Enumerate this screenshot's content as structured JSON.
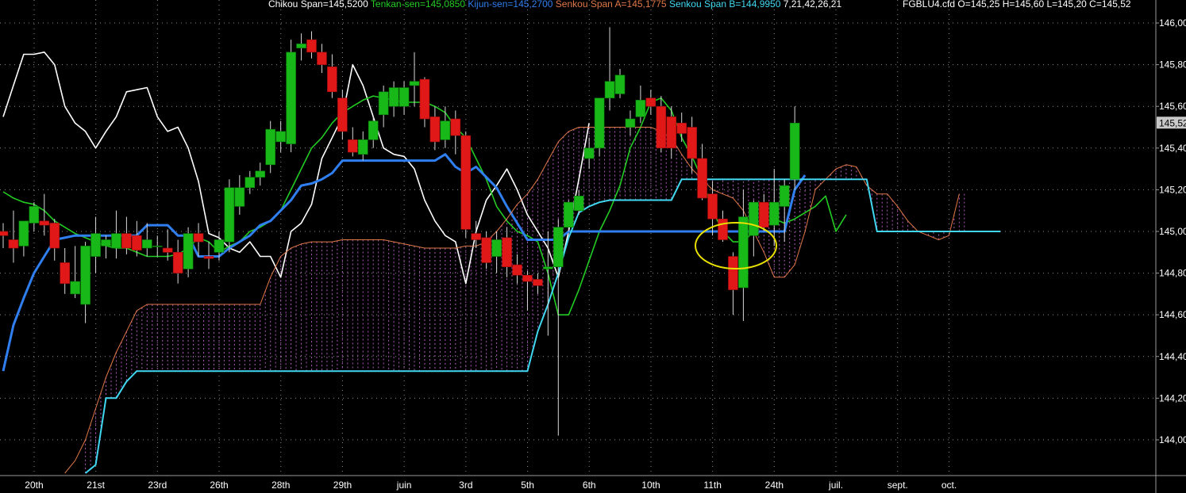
{
  "legend": {
    "chikou": "Chikou Span=145,5200",
    "tenkan": "Tenkan-sen=145,0850",
    "kijun": "Kijun-sen=145,2700",
    "spanA": "Senkou Span A=145,1775",
    "spanB": "Senkou Span B=144,9950",
    "params": "7,21,42,26,21",
    "ohlc": "FGBLU4.cfd O=145,25 H=145,60 L=145,20 C=145,52"
  },
  "colors": {
    "background": "#000000",
    "grid": "#8a8a8a",
    "up": "#18b818",
    "down": "#e01818",
    "chikou": "#ffffff",
    "tenkan": "#22cc22",
    "kijun": "#2f7ff0",
    "spanA": "#e07848",
    "spanB": "#40d8f0",
    "cloud": "#c060d0",
    "highlight": "#e8e000",
    "axis_text": "#ffffff"
  },
  "chart_data": {
    "type": "candlestick",
    "ylim": [
      143.84,
      146.08
    ],
    "y_ticks": [
      "146,00",
      "145,80",
      "145,60",
      "145,40",
      "145,20",
      "145,00",
      "144,80",
      "144,60",
      "144,40",
      "144,20",
      "144,00"
    ],
    "current_price_label": "145,52",
    "x_ticks": [
      {
        "label": "20th",
        "i": 1
      },
      {
        "label": "21st",
        "i": 7
      },
      {
        "label": "23rd",
        "i": 13
      },
      {
        "label": "26th",
        "i": 19
      },
      {
        "label": "28th",
        "i": 25
      },
      {
        "label": "29th",
        "i": 31
      },
      {
        "label": "juin",
        "i": 37
      },
      {
        "label": "3rd",
        "i": 43
      },
      {
        "label": "5th",
        "i": 49
      },
      {
        "label": "6th",
        "i": 55
      },
      {
        "label": "10th",
        "i": 61
      },
      {
        "label": "11th",
        "i": 67
      },
      {
        "label": "24th",
        "i": 73
      },
      {
        "label": "juil.",
        "i": 79
      },
      {
        "label": "sept.",
        "i": 85
      },
      {
        "label": "oct.",
        "i": 90
      }
    ],
    "candles": [
      {
        "o": 145.0,
        "h": 145.04,
        "l": 144.92,
        "c": 144.98
      },
      {
        "o": 144.96,
        "h": 145.1,
        "l": 144.85,
        "c": 144.92
      },
      {
        "o": 144.93,
        "h": 145.02,
        "l": 144.88,
        "c": 145.05
      },
      {
        "o": 145.04,
        "h": 145.14,
        "l": 145.0,
        "c": 145.12
      },
      {
        "o": 145.05,
        "h": 145.18,
        "l": 144.98,
        "c": 145.03
      },
      {
        "o": 145.04,
        "h": 145.06,
        "l": 144.86,
        "c": 144.92
      },
      {
        "o": 144.85,
        "h": 144.92,
        "l": 144.7,
        "c": 144.75
      },
      {
        "o": 144.7,
        "h": 144.93,
        "l": 144.68,
        "c": 144.76
      },
      {
        "o": 144.65,
        "h": 144.95,
        "l": 144.56,
        "c": 144.93
      },
      {
        "o": 144.88,
        "h": 145.07,
        "l": 144.8,
        "c": 144.99
      },
      {
        "o": 144.93,
        "h": 144.98,
        "l": 144.87,
        "c": 144.96
      },
      {
        "o": 144.92,
        "h": 145.1,
        "l": 144.87,
        "c": 144.99
      },
      {
        "o": 144.99,
        "h": 145.07,
        "l": 144.89,
        "c": 144.92
      },
      {
        "o": 144.98,
        "h": 145.05,
        "l": 144.88,
        "c": 144.91
      },
      {
        "o": 144.92,
        "h": 145.04,
        "l": 144.88,
        "c": 144.96
      },
      {
        "o": 144.93,
        "h": 144.98,
        "l": 144.88,
        "c": 144.93
      },
      {
        "o": 144.92,
        "h": 145.01,
        "l": 144.86,
        "c": 144.9
      },
      {
        "o": 144.9,
        "h": 144.96,
        "l": 144.75,
        "c": 144.8
      },
      {
        "o": 144.82,
        "h": 145.02,
        "l": 144.78,
        "c": 144.99
      },
      {
        "o": 144.99,
        "h": 145.04,
        "l": 144.88,
        "c": 144.95
      },
      {
        "o": 144.88,
        "h": 144.95,
        "l": 144.82,
        "c": 144.87
      },
      {
        "o": 144.9,
        "h": 145.0,
        "l": 144.86,
        "c": 144.96
      },
      {
        "o": 144.95,
        "h": 145.25,
        "l": 144.9,
        "c": 145.21
      },
      {
        "o": 145.12,
        "h": 145.27,
        "l": 145.08,
        "c": 145.21
      },
      {
        "o": 145.21,
        "h": 145.29,
        "l": 145.18,
        "c": 145.26
      },
      {
        "o": 145.26,
        "h": 145.33,
        "l": 145.22,
        "c": 145.29
      },
      {
        "o": 145.32,
        "h": 145.53,
        "l": 145.28,
        "c": 145.49
      },
      {
        "o": 145.43,
        "h": 145.53,
        "l": 145.38,
        "c": 145.48
      },
      {
        "o": 145.42,
        "h": 145.92,
        "l": 145.38,
        "c": 145.86
      },
      {
        "o": 145.88,
        "h": 145.95,
        "l": 145.82,
        "c": 145.9
      },
      {
        "o": 145.92,
        "h": 145.96,
        "l": 145.83,
        "c": 145.86
      },
      {
        "o": 145.86,
        "h": 145.9,
        "l": 145.76,
        "c": 145.8
      },
      {
        "o": 145.79,
        "h": 145.85,
        "l": 145.64,
        "c": 145.67
      },
      {
        "o": 145.64,
        "h": 145.68,
        "l": 145.44,
        "c": 145.48
      },
      {
        "o": 145.44,
        "h": 145.5,
        "l": 145.36,
        "c": 145.38
      },
      {
        "o": 145.37,
        "h": 145.48,
        "l": 145.34,
        "c": 145.44
      },
      {
        "o": 145.44,
        "h": 145.55,
        "l": 145.4,
        "c": 145.53
      },
      {
        "o": 145.56,
        "h": 145.7,
        "l": 145.5,
        "c": 145.67
      },
      {
        "o": 145.6,
        "h": 145.72,
        "l": 145.55,
        "c": 145.69
      },
      {
        "o": 145.6,
        "h": 145.72,
        "l": 145.56,
        "c": 145.69
      },
      {
        "o": 145.7,
        "h": 145.86,
        "l": 145.6,
        "c": 145.72
      },
      {
        "o": 145.73,
        "h": 145.74,
        "l": 145.5,
        "c": 145.54
      },
      {
        "o": 145.55,
        "h": 145.6,
        "l": 145.39,
        "c": 145.43
      },
      {
        "o": 145.44,
        "h": 145.6,
        "l": 145.4,
        "c": 145.53
      },
      {
        "o": 145.54,
        "h": 145.58,
        "l": 145.37,
        "c": 145.46
      },
      {
        "o": 145.46,
        "h": 145.48,
        "l": 144.97,
        "c": 145.01
      },
      {
        "o": 144.99,
        "h": 145.05,
        "l": 144.92,
        "c": 144.96
      },
      {
        "o": 144.97,
        "h": 145.0,
        "l": 144.82,
        "c": 144.85
      },
      {
        "o": 144.88,
        "h": 145.0,
        "l": 144.8,
        "c": 144.96
      },
      {
        "o": 144.97,
        "h": 145.02,
        "l": 144.78,
        "c": 144.83
      },
      {
        "o": 144.84,
        "h": 144.89,
        "l": 144.75,
        "c": 144.79
      },
      {
        "o": 144.79,
        "h": 144.81,
        "l": 144.62,
        "c": 144.76
      },
      {
        "o": 144.77,
        "h": 144.8,
        "l": 144.7,
        "c": 144.74
      },
      {
        "o": 144.82,
        "h": 145.0,
        "l": 144.5,
        "c": 144.83
      },
      {
        "o": 144.83,
        "h": 145.06,
        "l": 144.02,
        "c": 145.02
      },
      {
        "o": 145.02,
        "h": 145.15,
        "l": 145.0,
        "c": 145.14
      },
      {
        "o": 145.1,
        "h": 145.2,
        "l": 145.08,
        "c": 145.17
      },
      {
        "o": 145.35,
        "h": 145.45,
        "l": 145.3,
        "c": 145.4
      },
      {
        "o": 145.4,
        "h": 145.6,
        "l": 145.36,
        "c": 145.64
      },
      {
        "o": 145.64,
        "h": 145.98,
        "l": 145.58,
        "c": 145.72
      },
      {
        "o": 145.66,
        "h": 145.78,
        "l": 145.64,
        "c": 145.75
      },
      {
        "o": 145.5,
        "h": 145.58,
        "l": 145.46,
        "c": 145.54
      },
      {
        "o": 145.55,
        "h": 145.7,
        "l": 145.52,
        "c": 145.63
      },
      {
        "o": 145.64,
        "h": 145.68,
        "l": 145.56,
        "c": 145.6
      },
      {
        "o": 145.6,
        "h": 145.65,
        "l": 145.38,
        "c": 145.4
      },
      {
        "o": 145.55,
        "h": 145.6,
        "l": 145.35,
        "c": 145.4
      },
      {
        "o": 145.52,
        "h": 145.57,
        "l": 145.43,
        "c": 145.47
      },
      {
        "o": 145.5,
        "h": 145.55,
        "l": 145.28,
        "c": 145.35
      },
      {
        "o": 145.35,
        "h": 145.42,
        "l": 145.15,
        "c": 145.16
      },
      {
        "o": 145.18,
        "h": 145.24,
        "l": 144.98,
        "c": 145.06
      },
      {
        "o": 145.06,
        "h": 145.1,
        "l": 144.95,
        "c": 144.96
      },
      {
        "o": 144.88,
        "h": 144.9,
        "l": 144.6,
        "c": 144.72
      },
      {
        "o": 144.73,
        "h": 145.2,
        "l": 144.57,
        "c": 145.07
      },
      {
        "o": 144.98,
        "h": 145.15,
        "l": 144.88,
        "c": 145.14
      },
      {
        "o": 145.14,
        "h": 145.18,
        "l": 145.0,
        "c": 145.02
      },
      {
        "o": 145.03,
        "h": 145.3,
        "l": 144.93,
        "c": 145.14
      },
      {
        "o": 145.12,
        "h": 145.25,
        "l": 144.95,
        "c": 145.22
      },
      {
        "o": 145.25,
        "h": 145.6,
        "l": 145.2,
        "c": 145.52
      }
    ],
    "series": [
      {
        "name": "Chikou Span",
        "key": "chikou",
        "start": 0,
        "values": [
          145.55,
          145.7,
          145.85,
          145.85,
          145.86,
          145.8,
          145.6,
          145.52,
          145.48,
          145.4,
          145.48,
          145.55,
          145.67,
          145.68,
          145.69,
          145.55,
          145.48,
          145.5,
          145.4,
          145.24,
          144.99,
          144.97,
          144.92,
          144.9,
          144.95,
          144.88,
          144.88,
          144.78,
          145.0,
          145.04,
          145.13,
          145.35,
          145.45,
          145.55,
          145.8,
          145.7,
          145.55,
          145.4,
          145.37,
          145.36,
          145.3,
          145.15,
          145.05,
          144.98,
          144.95,
          144.75,
          145.0,
          145.15,
          145.22,
          145.3,
          145.2,
          145.08,
          145.0,
          144.92,
          144.78,
          145.0,
          145.25,
          145.52
        ]
      },
      {
        "name": "Tenkan-sen",
        "key": "tenkan",
        "start": 0,
        "values": [
          145.19,
          145.16,
          145.14,
          145.13,
          145.1,
          145.05,
          145.02,
          144.99,
          144.97,
          144.95,
          144.93,
          144.92,
          144.92,
          144.9,
          144.88,
          144.88,
          144.88,
          144.89,
          144.92,
          144.97,
          144.95,
          144.9,
          144.93,
          144.95,
          145.0,
          145.02,
          145.05,
          145.1,
          145.2,
          145.3,
          145.4,
          145.45,
          145.52,
          145.57,
          145.6,
          145.63,
          145.65,
          145.64,
          145.63,
          145.62,
          145.62,
          145.62,
          145.6,
          145.57,
          145.5,
          145.45,
          145.35,
          145.25,
          145.12,
          145.05,
          145.0,
          144.98,
          144.95,
          144.8,
          144.6,
          144.6,
          144.72,
          144.86,
          145.0,
          145.1,
          145.22,
          145.4,
          145.5,
          145.62,
          145.64,
          145.58,
          145.45,
          145.36,
          145.25,
          145.1,
          145.0,
          144.95,
          144.95,
          145.0,
          145.05,
          145.06,
          145.04,
          145.06,
          145.09,
          145.12,
          145.17,
          145.0,
          145.08
        ]
      },
      {
        "name": "Kijun-sen",
        "key": "kijun",
        "start": 0,
        "values": [
          144.33,
          144.55,
          144.68,
          144.8,
          144.88,
          144.96,
          144.97,
          144.98,
          144.98,
          144.98,
          144.98,
          144.98,
          144.98,
          144.98,
          145.03,
          145.03,
          145.03,
          144.98,
          144.98,
          144.88,
          144.88,
          144.88,
          144.92,
          144.95,
          144.98,
          145.03,
          145.05,
          145.1,
          145.15,
          145.22,
          145.23,
          145.25,
          145.28,
          145.34,
          145.34,
          145.34,
          145.34,
          145.34,
          145.34,
          145.34,
          145.34,
          145.34,
          145.34,
          145.37,
          145.31,
          145.28,
          145.31,
          145.26,
          145.21,
          145.12,
          145.04,
          144.96,
          144.96,
          144.96,
          144.96,
          145.0,
          145.0,
          145.0,
          145.0,
          145.0,
          145.0,
          145.0,
          145.0,
          145.0,
          145.0,
          145.0,
          145.0,
          145.0,
          145.0,
          145.0,
          145.0,
          145.0,
          145.0,
          145.0,
          145.0,
          145.0,
          145.0,
          145.2,
          145.27
        ]
      },
      {
        "name": "Senkou Span A",
        "key": "spanA",
        "start": 6,
        "values": [
          143.84,
          143.9,
          144.0,
          144.15,
          144.3,
          144.42,
          144.52,
          144.62,
          144.65,
          144.65,
          144.65,
          144.65,
          144.65,
          144.65,
          144.65,
          144.65,
          144.65,
          144.65,
          144.65,
          144.65,
          144.78,
          144.88,
          144.92,
          144.94,
          144.95,
          144.95,
          144.95,
          144.96,
          144.96,
          144.96,
          144.96,
          144.96,
          144.95,
          144.94,
          144.93,
          144.92,
          144.92,
          144.92,
          144.92,
          144.93,
          144.93,
          144.95,
          145.0,
          145.06,
          145.13,
          145.18,
          145.25,
          145.34,
          145.43,
          145.48,
          145.5,
          145.5,
          145.5,
          145.5,
          145.5,
          145.5,
          145.5,
          145.5,
          145.48,
          145.45,
          145.37,
          145.3,
          145.25,
          145.2,
          145.18,
          145.16,
          145.1,
          145.0,
          144.9,
          144.78,
          144.78,
          144.84,
          145.0,
          145.2,
          145.25,
          145.3,
          145.32,
          145.31,
          145.22,
          145.18,
          145.18,
          145.12,
          145.05,
          145.0,
          144.98,
          144.96,
          144.98,
          145.18
        ]
      },
      {
        "name": "Senkou Span B",
        "key": "spanB",
        "start": 8,
        "values": [
          143.84,
          143.88,
          144.2,
          144.2,
          144.28,
          144.33,
          144.33,
          144.33,
          144.33,
          144.33,
          144.33,
          144.33,
          144.33,
          144.33,
          144.33,
          144.33,
          144.33,
          144.33,
          144.33,
          144.33,
          144.33,
          144.33,
          144.33,
          144.33,
          144.33,
          144.33,
          144.33,
          144.33,
          144.33,
          144.33,
          144.33,
          144.33,
          144.33,
          144.33,
          144.33,
          144.33,
          144.33,
          144.33,
          144.33,
          144.33,
          144.33,
          144.33,
          144.33,
          144.33,
          144.52,
          144.65,
          144.8,
          144.97,
          145.09,
          145.12,
          145.14,
          145.15,
          145.15,
          145.15,
          145.15,
          145.15,
          145.15,
          145.15,
          145.25,
          145.25,
          145.25,
          145.25,
          145.25,
          145.25,
          145.25,
          145.25,
          145.25,
          145.25,
          145.25,
          145.25,
          145.25,
          145.25,
          145.25,
          145.25,
          145.25,
          145.25,
          145.25,
          145.0,
          145.0,
          145.0,
          145.0,
          145.0,
          145.0,
          145.0,
          145.0,
          145.0,
          145.0,
          145.0,
          145.0,
          145.0
        ]
      }
    ]
  }
}
